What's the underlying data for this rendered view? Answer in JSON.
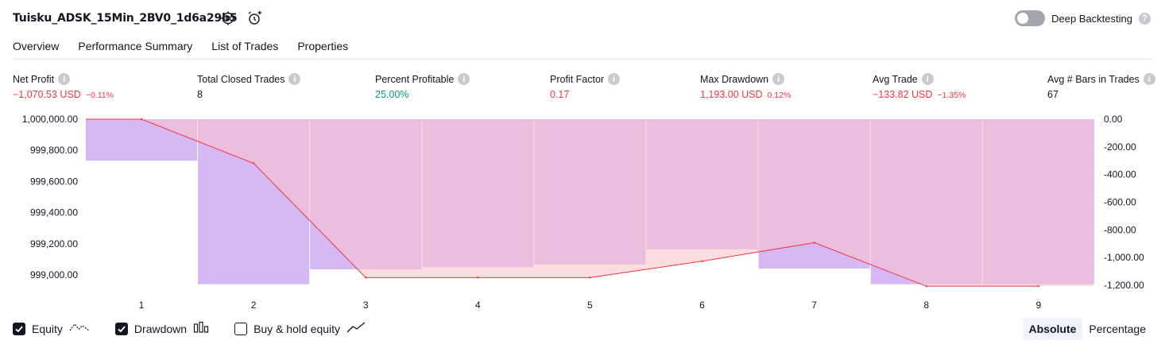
{
  "header": {
    "strategy_name": "Tuisku_ADSK_15Min_2BV0_1d6a29b5",
    "settings_icon": "gear-icon",
    "alert_icon": "add-alert-icon",
    "deep_backtesting_label": "Deep Backtesting",
    "deep_backtesting_enabled": false,
    "help_glyph": "?"
  },
  "tabs": [
    {
      "label": "Overview",
      "active": true
    },
    {
      "label": "Performance Summary",
      "active": false
    },
    {
      "label": "List of Trades",
      "active": false
    },
    {
      "label": "Properties",
      "active": false
    }
  ],
  "metrics": [
    {
      "label": "Net Profit",
      "value": "−1,070.53 USD",
      "pct": "−0.11%",
      "tone": "neg"
    },
    {
      "label": "Total Closed Trades",
      "value": "8",
      "pct": "",
      "tone": "neutral"
    },
    {
      "label": "Percent Profitable",
      "value": "25.00%",
      "pct": "",
      "tone": "pos"
    },
    {
      "label": "Profit Factor",
      "value": "0.17",
      "pct": "",
      "tone": "neg"
    },
    {
      "label": "Max Drawdown",
      "value": "1,193.00 USD",
      "pct": "0.12%",
      "tone": "neg"
    },
    {
      "label": "Avg Trade",
      "value": "−133.82 USD",
      "pct": "−1.35%",
      "tone": "neg"
    },
    {
      "label": "Avg # Bars in Trades",
      "value": "67",
      "pct": "",
      "tone": "neutral"
    }
  ],
  "chart_data": {
    "type": "line",
    "x": [
      1,
      2,
      3,
      4,
      5,
      6,
      7,
      8,
      9
    ],
    "series": [
      {
        "name": "Equity",
        "axis": "left",
        "values": [
          1000000.0,
          999717.0,
          998984.0,
          998984.0,
          998984.0,
          999089.0,
          999208.0,
          998929.0,
          998929.0
        ]
      },
      {
        "name": "Drawdown",
        "axis": "right",
        "type": "bar",
        "values": [
          -300,
          -1193,
          -1085,
          -1070,
          -1050,
          -940,
          -1080,
          -1193,
          -1193
        ]
      }
    ],
    "left_axis": {
      "ticks": [
        "1,000,000.00",
        "999,800.00",
        "999,600.00",
        "999,400.00",
        "999,200.00",
        "999,000.00"
      ],
      "ylim": [
        998935,
        1000000
      ]
    },
    "right_axis": {
      "ticks": [
        "0.00",
        "-200.00",
        "-400.00",
        "-600.00",
        "-800.00",
        "-1,000.00",
        "-1,200.00"
      ],
      "ylim": [
        -1200,
        0
      ]
    },
    "x_ticks": [
      "1",
      "2",
      "3",
      "4",
      "5",
      "6",
      "7",
      "8",
      "9"
    ],
    "colors": {
      "equity_line": "#f23645",
      "equity_fill": "#fbc3c7",
      "drawdown_bar": "#d6b8f5",
      "drawdown_bar_top": "#e2bdf2",
      "drawdown_bar_bottom": "#ec86aa"
    }
  },
  "legend": [
    {
      "label": "Equity",
      "checked": true,
      "icon": "equity-line-icon"
    },
    {
      "label": "Drawdown",
      "checked": true,
      "icon": "drawdown-bars-icon"
    },
    {
      "label": "Buy & hold equity",
      "checked": false,
      "icon": "buy-hold-line-icon"
    }
  ],
  "mode": {
    "absolute_label": "Absolute",
    "percentage_label": "Percentage",
    "selected": "Absolute"
  }
}
